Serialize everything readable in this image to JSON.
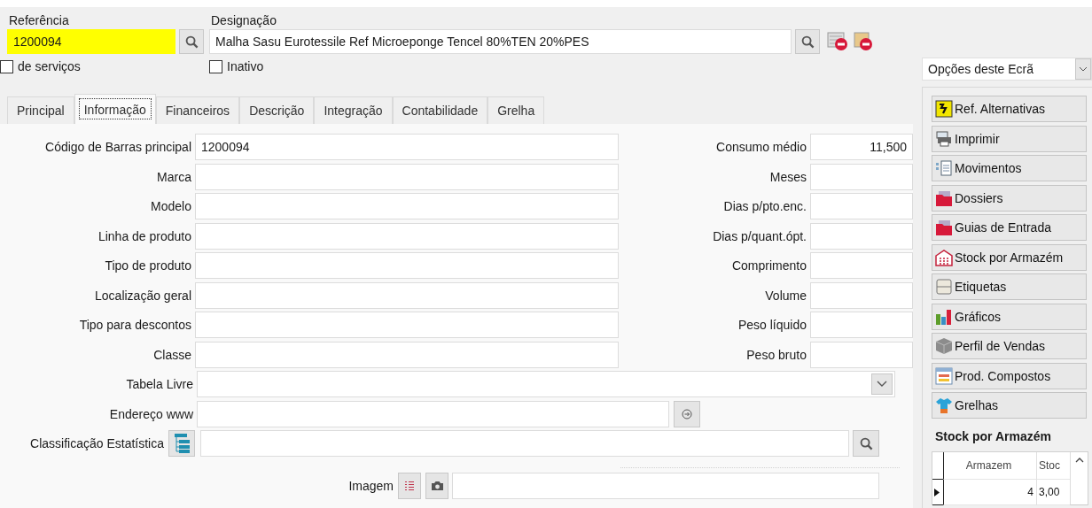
{
  "header": {
    "reference": {
      "label": "Referência",
      "value": "1200094"
    },
    "designation": {
      "label": "Designação",
      "value": "Malha Sasu Eurotessile Ref Microeponge Tencel 80%TEN 20%PES"
    },
    "checkboxes": [
      {
        "label": "de serviços",
        "checked": false
      },
      {
        "label": "Inativo",
        "checked": false
      }
    ]
  },
  "tabs": [
    {
      "label": "Principal",
      "selected": false
    },
    {
      "label": "Informação",
      "selected": true
    },
    {
      "label": "Financeiros",
      "selected": false
    },
    {
      "label": "Descrição",
      "selected": false
    },
    {
      "label": "Integração",
      "selected": false
    },
    {
      "label": "Contabilidade",
      "selected": false
    },
    {
      "label": "Grelha",
      "selected": false
    }
  ],
  "form_rows": [
    {
      "left": {
        "label": "Código de Barras principal",
        "value": "1200094"
      },
      "right": {
        "label": "Consumo médio",
        "value": "11,500"
      }
    },
    {
      "left": {
        "label": "Marca"
      },
      "right": {
        "label": "Meses"
      }
    },
    {
      "left": {
        "label": "Modelo"
      },
      "right": {
        "label": "Dias p/pto.enc."
      }
    },
    {
      "left": {
        "label": "Linha de produto"
      },
      "right": {
        "label": "Dias p/quant.ópt."
      }
    },
    {
      "left": {
        "label": "Tipo de produto"
      },
      "right": {
        "label": "Comprimento"
      }
    },
    {
      "left": {
        "label": "Localização geral"
      },
      "right": {
        "label": "Volume"
      }
    },
    {
      "left": {
        "label": "Tipo para descontos"
      },
      "right": {
        "label": "Peso líquido"
      }
    },
    {
      "left": {
        "label": "Classe"
      },
      "right": {
        "label": "Peso bruto"
      }
    }
  ],
  "wide_fields": [
    {
      "kind": "dropdown",
      "label": "Tabela Livre"
    },
    {
      "kind": "link",
      "label": "Endereço www"
    },
    {
      "kind": "tree",
      "label": "Classificação Estatística"
    }
  ],
  "image_field": {
    "label": "Imagem"
  },
  "options": {
    "dropdown": "Opções deste Ecrã",
    "buttons": [
      {
        "kind": "alternatives",
        "label": "Ref. Alternativas"
      },
      {
        "kind": "print",
        "label": "Imprimir"
      },
      {
        "kind": "movements",
        "label": "Movimentos"
      },
      {
        "kind": "folder",
        "label": "Dossiers"
      },
      {
        "kind": "folder",
        "label": "Guias de Entrada"
      },
      {
        "kind": "warehouse",
        "label": "Stock por Armazém"
      },
      {
        "kind": "labels",
        "label": "Etiquetas"
      },
      {
        "kind": "charts",
        "label": "Gráficos"
      },
      {
        "kind": "box",
        "label": "Perfil de Vendas"
      },
      {
        "kind": "composite",
        "label": "Prod. Compostos"
      },
      {
        "kind": "shirt",
        "label": "Grelhas"
      }
    ]
  },
  "stock_panel": {
    "title": "Stock por Armazém",
    "columns": [
      "Armazem",
      "Stoc"
    ],
    "rows": [
      {
        "cells": [
          "4",
          "3,00"
        ],
        "selected": true
      }
    ]
  }
}
